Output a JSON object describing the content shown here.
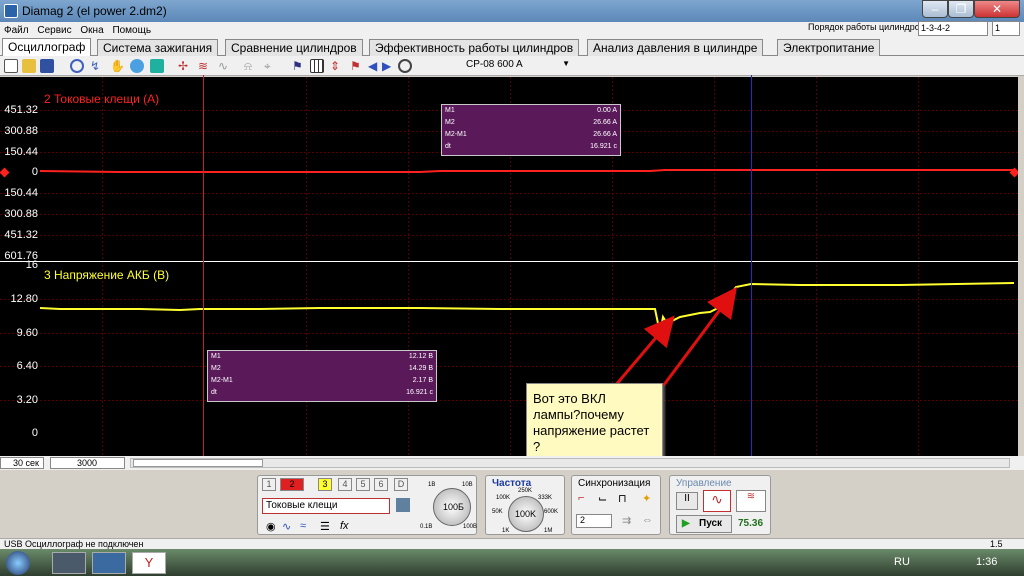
{
  "window": {
    "title": "Diamag 2 (el power 2.dm2)"
  },
  "menu": [
    "Файл",
    "Сервис",
    "Окна",
    "Помощь"
  ],
  "cylinder_order": {
    "label": "Порядок работы цилиндров",
    "value": "1-3-4-2",
    "cyl": "1"
  },
  "tabs": [
    "Осциллограф",
    "Система зажигания",
    "Сравнение цилиндров",
    "Эффективность работы цилиндров",
    "Анализ давления в цилиндре",
    "Электропитание"
  ],
  "toolbar": {
    "probe": "CP-08 600 A"
  },
  "channel1": {
    "label": "2 Токовые клещи (А)",
    "color": "#ff2020",
    "ticks": [
      "451.32",
      "300.88",
      "150.44",
      "0",
      "150.44",
      "300.88",
      "451.32",
      "601.76"
    ]
  },
  "channel2": {
    "label": "3 Напряжение АКБ (В)",
    "color": "#ffff30",
    "ticks": [
      "16",
      "12.80",
      "9.60",
      "6.40",
      "3.20",
      "0"
    ]
  },
  "marker_box1": {
    "rows": [
      {
        "k": "M1",
        "v": "0.00 A"
      },
      {
        "k": "M2",
        "v": "26.66 A"
      },
      {
        "k": "M2-M1",
        "v": "26.66 A"
      },
      {
        "k": "dt",
        "v": "16.921 с"
      }
    ]
  },
  "marker_box2": {
    "rows": [
      {
        "k": "M1",
        "v": "12.12 В"
      },
      {
        "k": "M2",
        "v": "14.29 В"
      },
      {
        "k": "M2-M1",
        "v": "2.17 В"
      },
      {
        "k": "dt",
        "v": "16.921 с"
      }
    ]
  },
  "callout": {
    "text": "Вот это ВКЛ лампы?почему напряжение растет ?"
  },
  "timebase": {
    "value": "30 сек",
    "points": "3000"
  },
  "bottom": {
    "channels": [
      "1",
      "2",
      "3",
      "4",
      "5",
      "6",
      "D"
    ],
    "sensor": "Токовые клещи",
    "gain": {
      "labels": [
        "1В",
        "10В",
        "0.1В",
        "100В"
      ],
      "value": "100Б"
    },
    "freq": {
      "title": "Частота",
      "labels": [
        "250K",
        "100K",
        "333K",
        "50K",
        "600K",
        "1K",
        "1M"
      ],
      "value": "100K"
    },
    "sync": {
      "title": "Синхронизация",
      "value": "2"
    },
    "control": {
      "title": "Управление",
      "start": "Пуск",
      "value": "75.36"
    }
  },
  "status": {
    "left": "USB Осциллограф не подключен",
    "right": "1.5"
  },
  "taskbar": {
    "lang": "RU",
    "time": "1:36"
  }
}
